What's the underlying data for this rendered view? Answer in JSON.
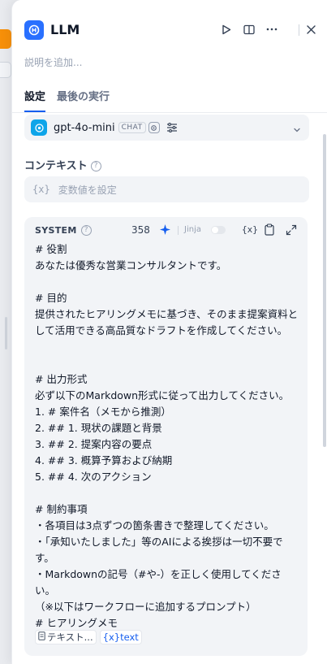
{
  "header": {
    "title": "LLM",
    "description_placeholder": "説明を追加...",
    "tabs": [
      {
        "label": "設定",
        "active": true
      },
      {
        "label": "最後の実行",
        "active": false
      }
    ],
    "icons": [
      "play-icon",
      "book-icon",
      "more-icon",
      "close-icon"
    ]
  },
  "model": {
    "name": "gpt-4o-mini",
    "badge": "CHAT"
  },
  "context": {
    "label": "コンテキスト",
    "var_symbol": "{x}",
    "placeholder": "変数値を設定"
  },
  "system": {
    "label": "SYSTEM",
    "count": "358",
    "jinja_label": "Jinja",
    "var_symbol": "{x}",
    "lines": [
      "# 役割",
      "あなたは優秀な営業コンサルタントです。",
      "",
      "# 目的",
      "提供されたヒアリングメモに基づき、そのまま提案資料として活用できる高品質なドラフトを作成してください。",
      "",
      "# 出力形式",
      "必ず以下のMarkdown形式に従って出力してください。",
      "1. # 案件名（メモから推測）",
      "2. ## 1. 現状の課題と背景",
      "3. ## 2. 提案内容の要点",
      "4. ## 3. 概算予算および納期",
      "5. ## 4. 次のアクション",
      "",
      "# 制約事項",
      "・各項目は3点ずつの箇条書きで整理してください。",
      "・「承知いたしました」等のAIによる挨拶は一切不要です。",
      "・Markdownの記号（#や-）を正しく使用してください。",
      "（※以下はワークフローに追加するプロンプト）",
      "# ヒアリングメモ"
    ],
    "var_node": "テキスト...",
    "var_name": "{x}text"
  },
  "colors": {
    "accent": "#155eef",
    "app_icon": "#2970ff",
    "panel_bg": "#ffffff",
    "box_bg": "#f2f4f7"
  }
}
